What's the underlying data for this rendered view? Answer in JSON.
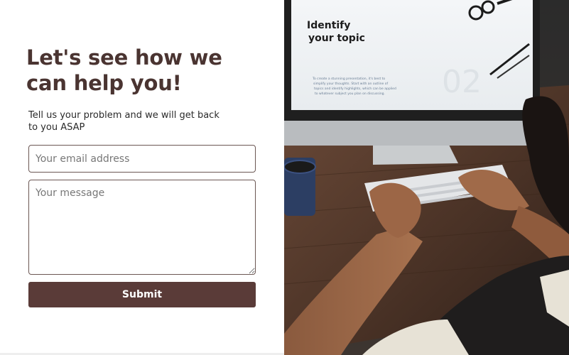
{
  "contact": {
    "heading": "Let's see how we can help you!",
    "subtext": "Tell us your problem and we will get back to you ASAP",
    "email_placeholder": "Your email address",
    "message_placeholder": "Your message",
    "submit_label": "Submit"
  },
  "photo": {
    "screen_title": "Identify your topic",
    "screen_body": "To create a stunning presentation, it's best to simplify your thoughts. Start with an outline of topics and identify highlights, which can be applied to whatever subject you plan on discussing.",
    "screen_number": "02"
  },
  "colors": {
    "heading": "#4a3431",
    "button": "#5a3b38",
    "field_border": "#6b5753"
  }
}
